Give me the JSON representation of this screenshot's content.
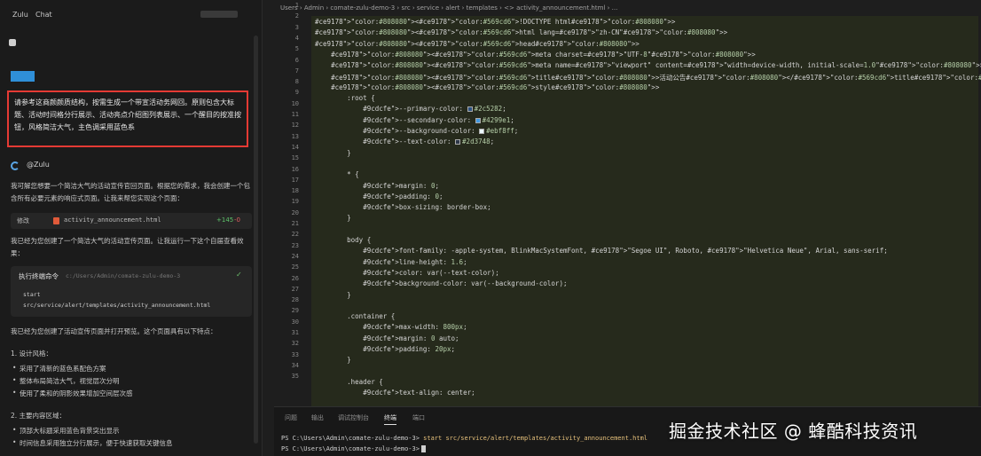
{
  "chat": {
    "tabs": [
      "Zulu",
      "Chat"
    ],
    "title": "",
    "user_message": "请参考这商颜颜质结构，按需生成一个带宣活动务网回。原则包含大标题、活动时间格分行展示、活动亮点介绍图列表展示、一个醒目的按准按钮，风格简洁大气，主色调采用蓝色系",
    "assistant_name": "@Zulu",
    "intro_text": "我可解您想要一个简洁大气的活动宣传官回页面。根据您的需求，我会创建一个包含所有必要元素的响应式页面。让我来帮您实现这个页面：",
    "file_chip": {
      "badge": "修改",
      "name": "activity_announcement.html",
      "added": "+145",
      "removed": "-0"
    },
    "after_file_text": "我已经为您创建了一个简洁大气的活动宣传页面。让我运行一下这个自届查看效果：",
    "terminal_card": {
      "title": "执行终端命令",
      "path": "c:/Users/Admin/comate-zulu-demo-3",
      "cmd_line1": "start",
      "cmd_line2": "src/service/alert/templates/activity_announcement.html"
    },
    "done_text": "我已经为您创建了活动宣传页面并打开预览。这个页面具有以下特点：",
    "section1": {
      "heading": "1. 设计风格：",
      "bullets": [
        "采用了清新的蓝色系配色方案",
        "整体布局简洁大气，视觉层次分明",
        "使用了柔和的阴影效果增加空间层次感"
      ]
    },
    "section2": {
      "heading": "2. 主要内容区域：",
      "bullets": [
        "顶部大标题采用蓝色背景突出显示",
        "时间信息采用独立分行展示，便于快速获取关键信息"
      ]
    }
  },
  "editor": {
    "breadcrumb": "Users › Admin › comate-zulu-demo-3 › src › service › alert › templates › <> activity_announcement.html › ...",
    "code": [
      {
        "n": "1",
        "t": "<!DOCTYPE html>"
      },
      {
        "n": "2",
        "t": "<html lang=\"zh-CN\">"
      },
      {
        "n": "3",
        "t": "<head>"
      },
      {
        "n": "4",
        "t": "    <meta charset=\"UTF-8\">"
      },
      {
        "n": "5",
        "t": "    <meta name=\"viewport\" content=\"width=device-width, initial-scale=1.0\">"
      },
      {
        "n": "6",
        "t": "    <title>活动公告</title>"
      },
      {
        "n": "7",
        "t": "    <style>"
      },
      {
        "n": "8",
        "t": "        :root {"
      },
      {
        "n": "9",
        "t": "            --primary-color: #2c5282;"
      },
      {
        "n": "10",
        "t": "            --secondary-color: #4299e1;"
      },
      {
        "n": "11",
        "t": "            --background-color: #ebf8ff;"
      },
      {
        "n": "12",
        "t": "            --text-color: #2d3748;"
      },
      {
        "n": "13",
        "t": "        }"
      },
      {
        "n": "14",
        "t": ""
      },
      {
        "n": "15",
        "t": "        * {"
      },
      {
        "n": "16",
        "t": "            margin: 0;"
      },
      {
        "n": "17",
        "t": "            padding: 0;"
      },
      {
        "n": "18",
        "t": "            box-sizing: border-box;"
      },
      {
        "n": "19",
        "t": "        }"
      },
      {
        "n": "20",
        "t": ""
      },
      {
        "n": "21",
        "t": "        body {"
      },
      {
        "n": "22",
        "t": "            font-family: -apple-system, BlinkMacSystemFont, \"Segoe UI\", Roboto, \"Helvetica Neue\", Arial, sans-serif;"
      },
      {
        "n": "23",
        "t": "            line-height: 1.6;"
      },
      {
        "n": "24",
        "t": "            color: var(--text-color);"
      },
      {
        "n": "25",
        "t": "            background-color: var(--background-color);"
      },
      {
        "n": "26",
        "t": "        }"
      },
      {
        "n": "27",
        "t": ""
      },
      {
        "n": "28",
        "t": "        .container {"
      },
      {
        "n": "29",
        "t": "            max-width: 800px;"
      },
      {
        "n": "30",
        "t": "            margin: 0 auto;"
      },
      {
        "n": "31",
        "t": "            padding: 20px;"
      },
      {
        "n": "32",
        "t": "        }"
      },
      {
        "n": "33",
        "t": ""
      },
      {
        "n": "34",
        "t": "        .header {"
      },
      {
        "n": "35",
        "t": "            text-align: center;"
      }
    ],
    "swatches": {
      "primary": "#2c5282",
      "secondary": "#4299e1",
      "background": "#ebf8ff",
      "text": "#2d3748"
    }
  },
  "panel": {
    "tabs": [
      "问题",
      "输出",
      "调试控制台",
      "终端",
      "端口"
    ],
    "active_tab": "终端",
    "term_line1_prompt": "PS C:\\Users\\Admin\\comate-zulu-demo-3>",
    "term_line1_cmd": "start src/service/alert/templates/activity_announcement.html",
    "term_line2_prompt": "PS C:\\Users\\Admin\\comate-zulu-demo-3>"
  },
  "watermark": "掘金技术社区 @ 蜂酷科技资讯",
  "colors": {
    "highlight_border": "#e53a34",
    "accent_blue": "#2f8fd8",
    "code_bg": "#262a1c"
  }
}
